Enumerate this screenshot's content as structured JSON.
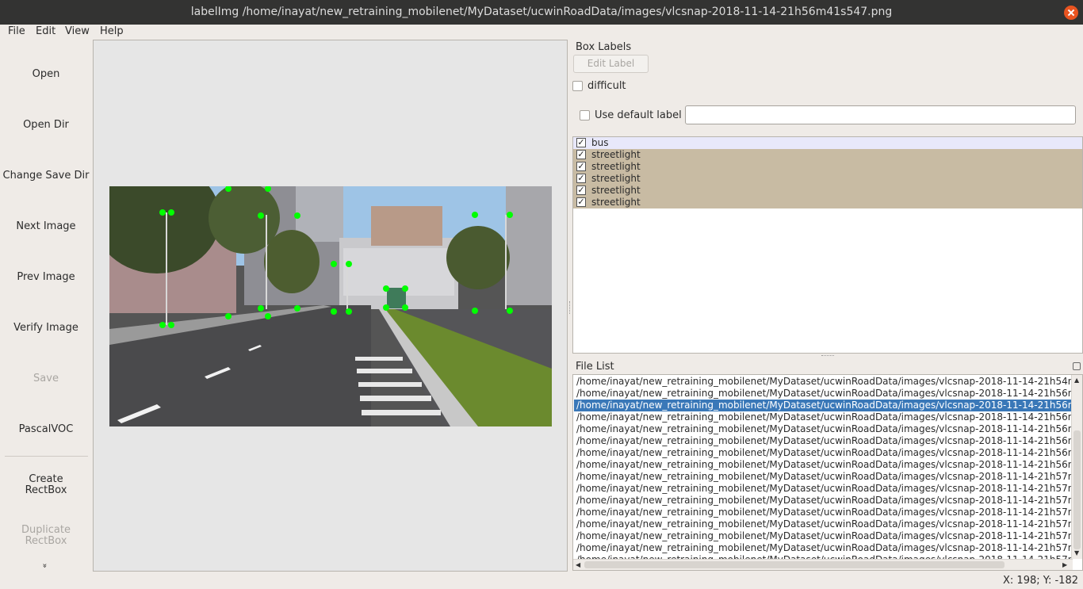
{
  "window": {
    "title": "labelImg /home/inayat/new_retraining_mobilenet/MyDataset/ucwinRoadData/images/vlcsnap-2018-11-14-21h56m41s547.png",
    "accent_close": "#e95420"
  },
  "menu": {
    "file": "File",
    "edit": "Edit",
    "view": "View",
    "help": "Help"
  },
  "toolbar": {
    "open": "Open",
    "open_dir": "Open Dir",
    "change_save_dir": "Change Save Dir",
    "next_image": "Next Image",
    "prev_image": "Prev Image",
    "verify_image": "Verify Image",
    "save": "Save",
    "format": "PascalVOC",
    "create_rectbox_line1": "Create",
    "create_rectbox_line2": "RectBox",
    "duplicate_rectbox_line1": "Duplicate",
    "duplicate_rectbox_line2": "RectBox",
    "more": "»"
  },
  "box_labels": {
    "title": "Box Labels",
    "edit_label_button": "Edit Label",
    "difficult": "difficult",
    "use_default_label": "Use default label",
    "default_label_value": "",
    "labels": [
      {
        "name": "bus",
        "checked": true,
        "color": "#e8e8fa"
      },
      {
        "name": "streetlight",
        "checked": true,
        "color": "#c8bba3"
      },
      {
        "name": "streetlight",
        "checked": true,
        "color": "#c8bba3"
      },
      {
        "name": "streetlight",
        "checked": true,
        "color": "#c8bba3"
      },
      {
        "name": "streetlight",
        "checked": true,
        "color": "#c8bba3"
      },
      {
        "name": "streetlight",
        "checked": true,
        "color": "#c8bba3"
      }
    ]
  },
  "file_list": {
    "title": "File List",
    "selected_index": 2,
    "items": [
      "/home/inayat/new_retraining_mobilenet/MyDataset/ucwinRoadData/images/vlcsnap-2018-11-14-21h54n",
      "/home/inayat/new_retraining_mobilenet/MyDataset/ucwinRoadData/images/vlcsnap-2018-11-14-21h56n",
      "/home/inayat/new_retraining_mobilenet/MyDataset/ucwinRoadData/images/vlcsnap-2018-11-14-21h56n",
      "/home/inayat/new_retraining_mobilenet/MyDataset/ucwinRoadData/images/vlcsnap-2018-11-14-21h56n",
      "/home/inayat/new_retraining_mobilenet/MyDataset/ucwinRoadData/images/vlcsnap-2018-11-14-21h56n",
      "/home/inayat/new_retraining_mobilenet/MyDataset/ucwinRoadData/images/vlcsnap-2018-11-14-21h56n",
      "/home/inayat/new_retraining_mobilenet/MyDataset/ucwinRoadData/images/vlcsnap-2018-11-14-21h56n",
      "/home/inayat/new_retraining_mobilenet/MyDataset/ucwinRoadData/images/vlcsnap-2018-11-14-21h56n",
      "/home/inayat/new_retraining_mobilenet/MyDataset/ucwinRoadData/images/vlcsnap-2018-11-14-21h57n",
      "/home/inayat/new_retraining_mobilenet/MyDataset/ucwinRoadData/images/vlcsnap-2018-11-14-21h57n",
      "/home/inayat/new_retraining_mobilenet/MyDataset/ucwinRoadData/images/vlcsnap-2018-11-14-21h57n",
      "/home/inayat/new_retraining_mobilenet/MyDataset/ucwinRoadData/images/vlcsnap-2018-11-14-21h57n",
      "/home/inayat/new_retraining_mobilenet/MyDataset/ucwinRoadData/images/vlcsnap-2018-11-14-21h57n",
      "/home/inayat/new_retraining_mobilenet/MyDataset/ucwinRoadData/images/vlcsnap-2018-11-14-21h57n",
      "/home/inayat/new_retraining_mobilenet/MyDataset/ucwinRoadData/images/vlcsnap-2018-11-14-21h57n",
      "/home/inayat/new_retraining_mobilenet/MyDataset/ucwinRoadData/images/vlcsnap-2018-11-14-21h57n"
    ],
    "selection_color": "#3a78b8"
  },
  "status": {
    "coords": "X: 198; Y: -182"
  },
  "annotation_color": "#00ff00"
}
